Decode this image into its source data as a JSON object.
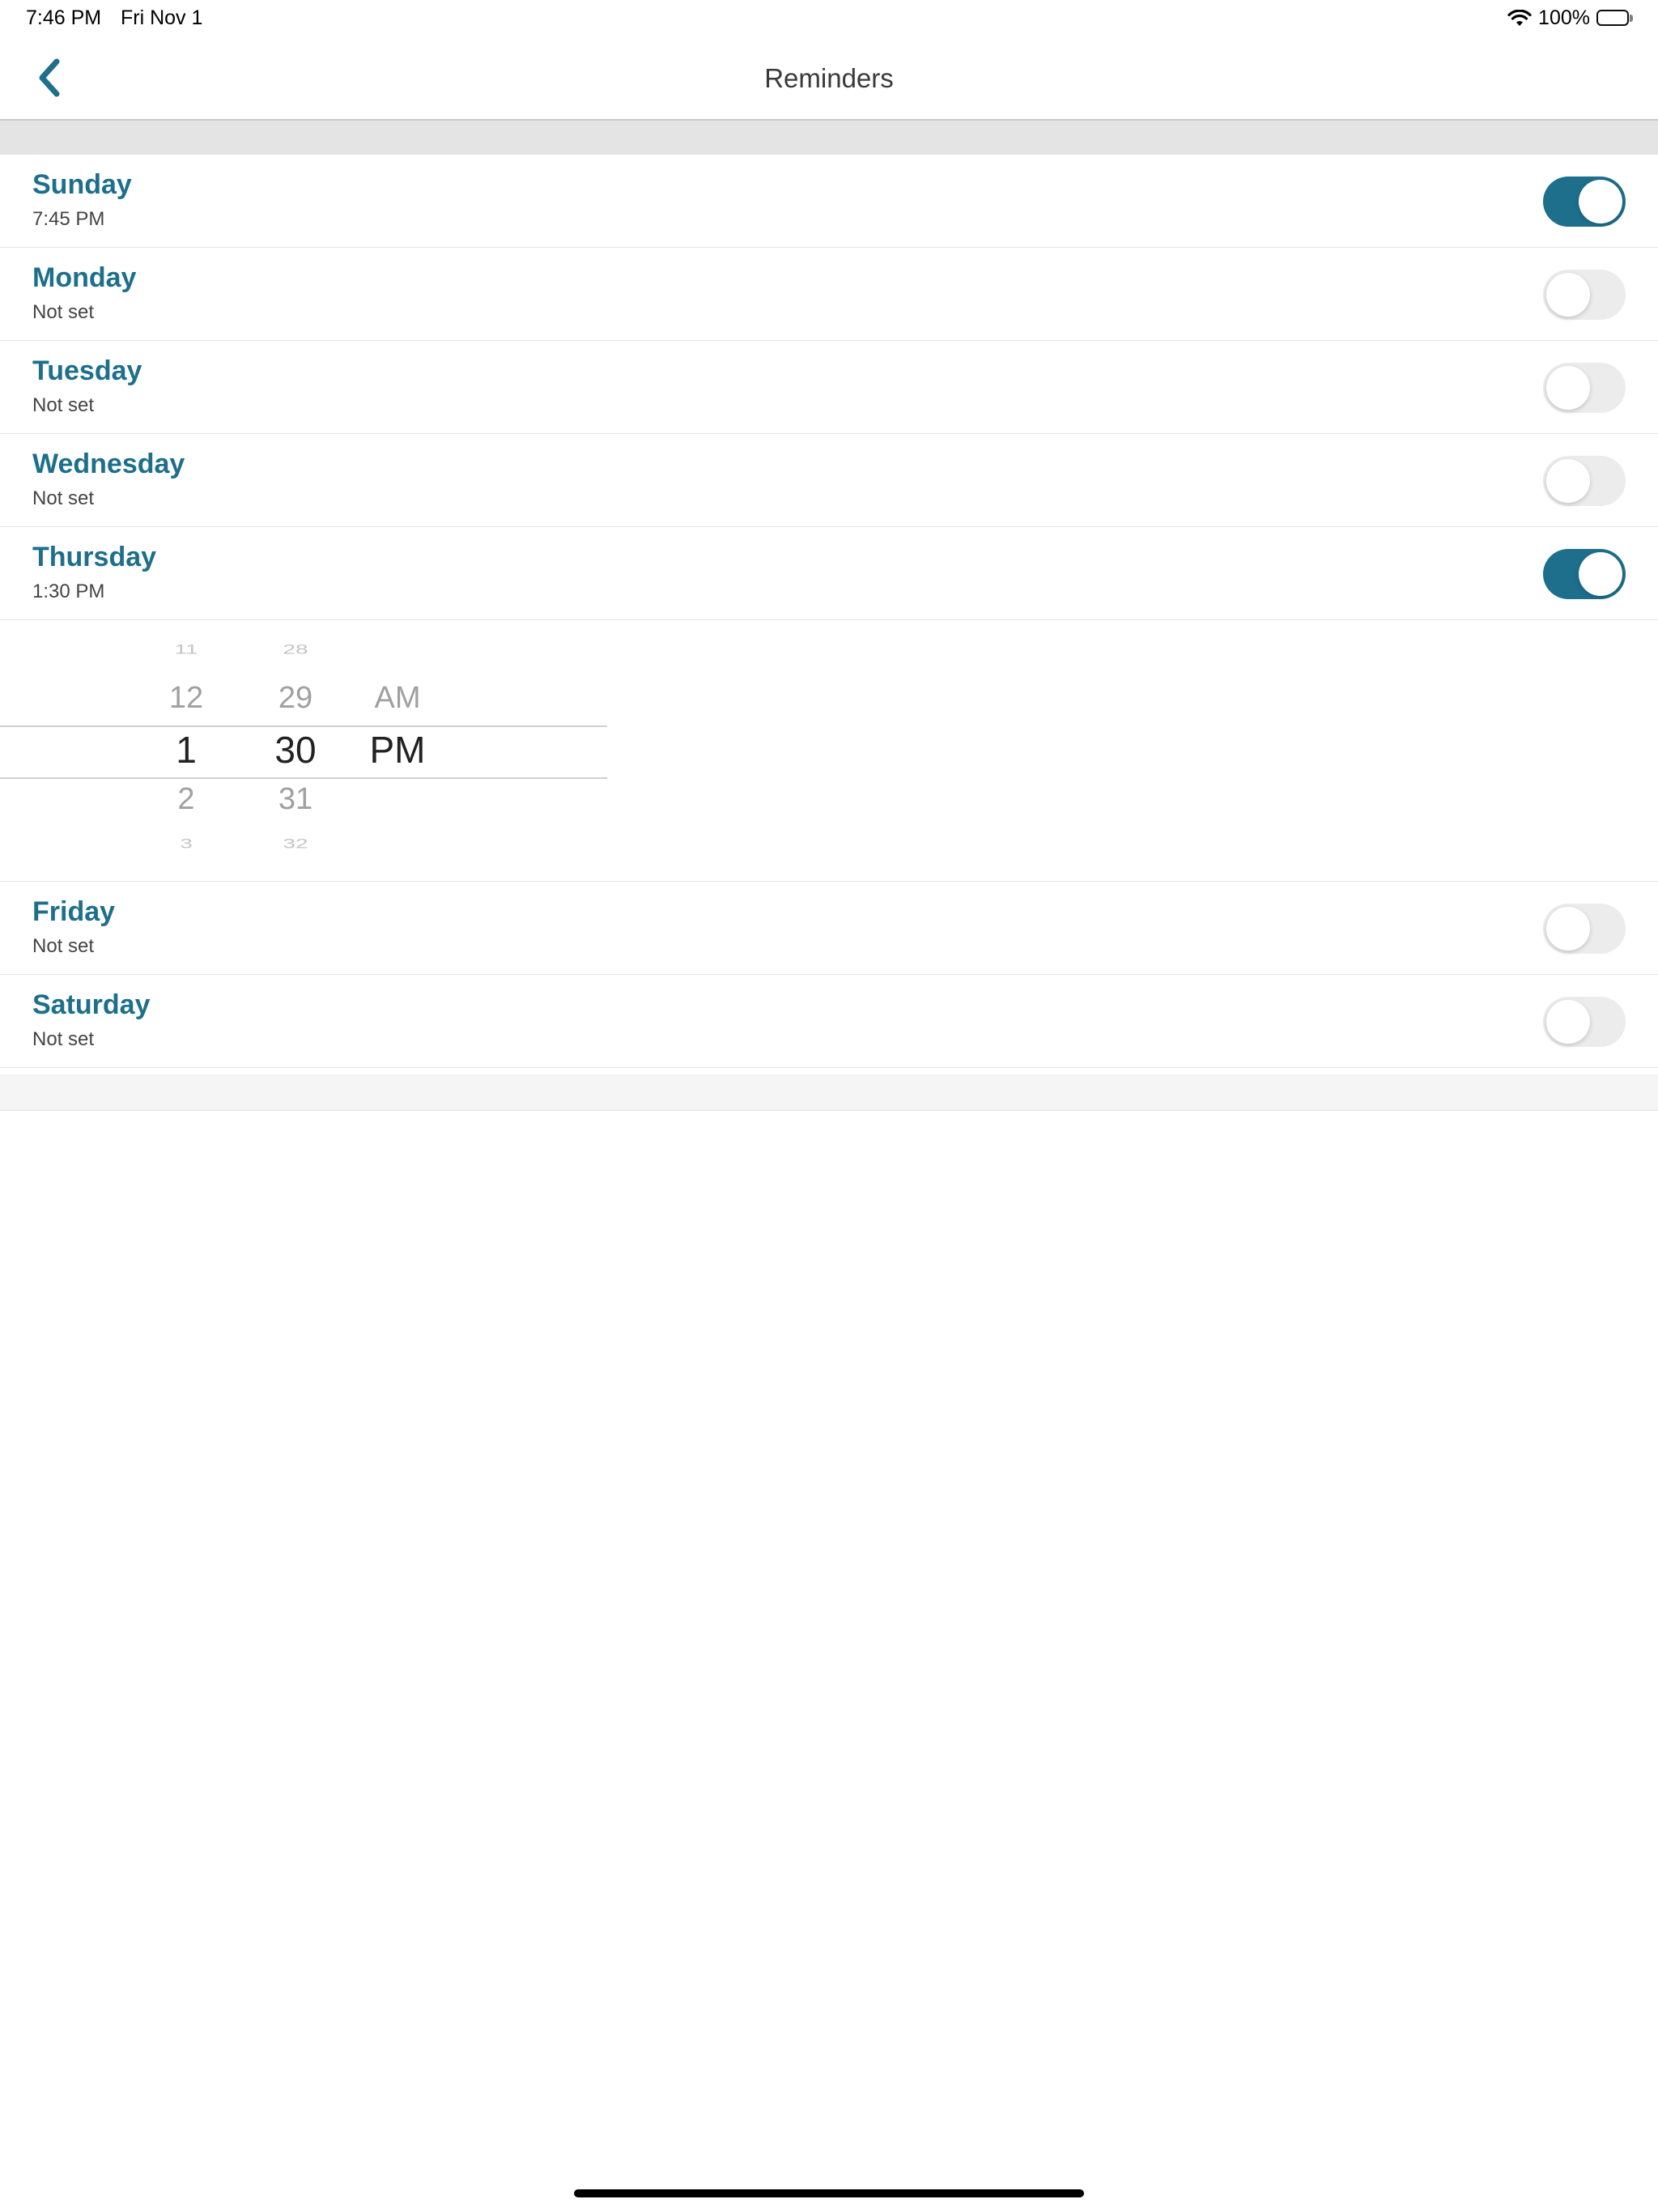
{
  "status_bar": {
    "time": "7:46 PM",
    "date": "Fri Nov 1",
    "battery_percent": "100%",
    "battery_level": 1.0,
    "wifi_icon": "wifi-icon",
    "battery_icon": "battery-icon"
  },
  "nav": {
    "title": "Reminders",
    "back_icon": "chevron-left-icon"
  },
  "colors": {
    "accent": "#1d6f8c",
    "toggle_off": "#ececec",
    "section_header": "#e4e4e4"
  },
  "reminders": [
    {
      "day": "Sunday",
      "time": "7:45 PM",
      "enabled": true
    },
    {
      "day": "Monday",
      "time": "Not set",
      "enabled": false
    },
    {
      "day": "Tuesday",
      "time": "Not set",
      "enabled": false
    },
    {
      "day": "Wednesday",
      "time": "Not set",
      "enabled": false
    },
    {
      "day": "Thursday",
      "time": "1:30 PM",
      "enabled": true
    },
    {
      "day": "Friday",
      "time": "Not set",
      "enabled": false
    },
    {
      "day": "Saturday",
      "time": "Not set",
      "enabled": false
    }
  ],
  "time_picker": {
    "hours": [
      "11",
      "12",
      "1",
      "2",
      "3"
    ],
    "minutes": [
      "28",
      "29",
      "30",
      "31",
      "32"
    ],
    "periods": [
      "AM",
      "PM"
    ],
    "selected_hour": "1",
    "selected_minute": "30",
    "selected_period": "PM"
  }
}
